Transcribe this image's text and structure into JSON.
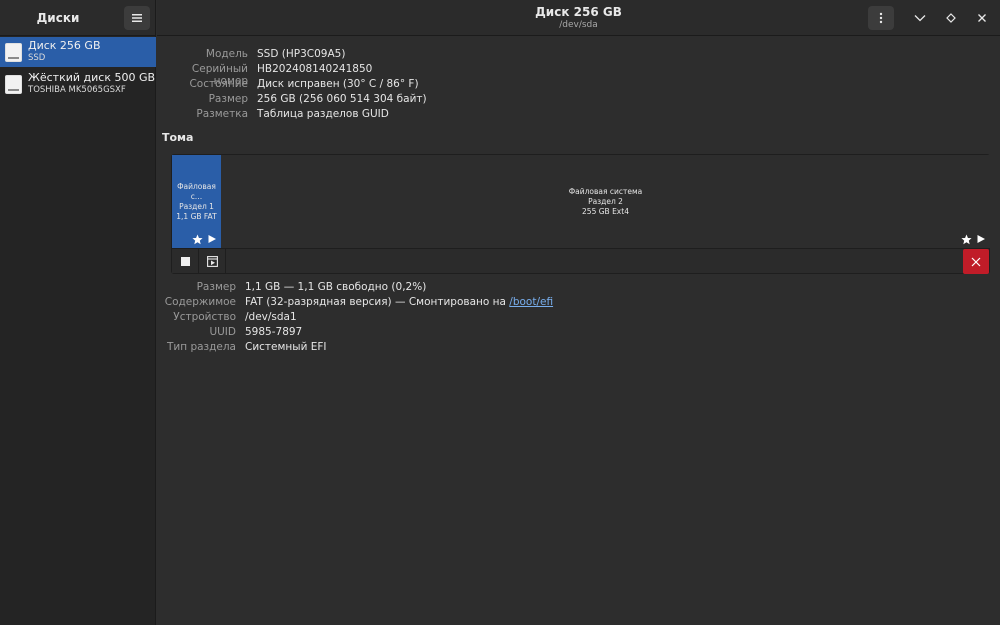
{
  "sidebar": {
    "title": "Диски",
    "disks": [
      {
        "name": "Диск 256 GB",
        "sub": "SSD"
      },
      {
        "name": "Жёсткий диск 500 GB",
        "sub": "TOSHIBA MK5065GSXF"
      }
    ]
  },
  "header": {
    "title": "Диск 256 GB",
    "subtitle": "/dev/sda"
  },
  "disk_info": {
    "model_label": "Модель",
    "model_value": "SSD (HP3C09A5)",
    "serial_label": "Серийный номер",
    "serial_value": "HB202408140241850",
    "state_label": "Состояние",
    "state_value": "Диск исправен (30° C / 86° F)",
    "size_label": "Размер",
    "size_value": "256 GB (256 060 514 304 байт)",
    "partitioning_label": "Разметка",
    "partitioning_value": "Таблица разделов GUID"
  },
  "volumes": {
    "title": "Тома",
    "partitions": [
      {
        "line1": "Файловая с…",
        "line2": "Раздел 1",
        "line3": "1,1 GB FAT"
      },
      {
        "line1": "Файловая система",
        "line2": "Раздел 2",
        "line3": "255 GB Ext4"
      }
    ]
  },
  "volume_info": {
    "size_label": "Размер",
    "size_value": "1,1 GB — 1,1 GB свободно (0,2%)",
    "contents_label": "Содержимое",
    "contents_value": "FAT (32-разрядная версия) — Смонтировано на ",
    "contents_link": "/boot/efi",
    "device_label": "Устройство",
    "device_value": "/dev/sda1",
    "uuid_label": "UUID",
    "uuid_value": "5985-7897",
    "type_label": "Тип раздела",
    "type_value": "Системный EFI"
  },
  "icons": {
    "menu": "hamburger-icon",
    "kebab": "kebab-icon",
    "chevron": "chevron-down-icon",
    "diamond": "diamond-icon",
    "close": "close-icon",
    "star": "star-icon",
    "play": "play-icon",
    "stop": "stop-icon",
    "mount": "mount-icon",
    "delete": "delete-icon",
    "disk": "disk-icon"
  },
  "colors": {
    "accent": "#2a5ea8",
    "destructive": "#c01c28",
    "link": "#78aeed"
  }
}
